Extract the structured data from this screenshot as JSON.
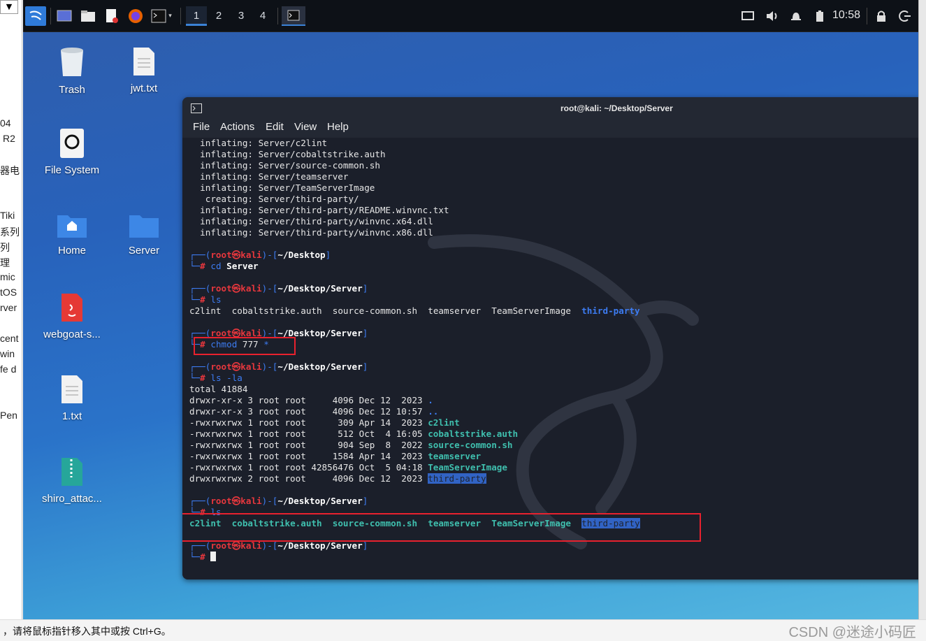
{
  "host": {
    "left_texts": [
      "04",
      "R2",
      "器电",
      "Tiki",
      "系列",
      "列",
      "理",
      "mic",
      "tOS",
      "rver",
      "cent",
      "win",
      "fe d",
      "Pen"
    ],
    "status_text": "，请将鼠标指针移入其中或按 Ctrl+G。",
    "watermark": "CSDN @迷途小码匠",
    "dropdown_glyph": "▼"
  },
  "taskbar": {
    "workspaces": [
      "1",
      "2",
      "3",
      "4"
    ],
    "active_workspace": "1",
    "clock": "10:58"
  },
  "desktop_icons": [
    {
      "label": "Trash",
      "icon": "trash-icon"
    },
    {
      "label": "jwt.txt",
      "icon": "text-file-icon"
    },
    {
      "label": "File System",
      "icon": "drive-icon"
    },
    {
      "label": "Home",
      "icon": "home-folder-icon"
    },
    {
      "label": "Server",
      "icon": "folder-icon"
    },
    {
      "label": "webgoat-s...",
      "icon": "java-file-icon"
    },
    {
      "label": "1.txt",
      "icon": "text-file-icon"
    },
    {
      "label": "shiro_attac...",
      "icon": "archive-icon"
    }
  ],
  "terminal": {
    "title": "root@kali: ~/Desktop/Server",
    "menu": [
      "File",
      "Actions",
      "Edit",
      "View",
      "Help"
    ],
    "unzip_lines": [
      "  inflating: Server/c2lint",
      "  inflating: Server/cobaltstrike.auth",
      "  inflating: Server/source-common.sh",
      "  inflating: Server/teamserver",
      "  inflating: Server/TeamServerImage",
      "   creating: Server/third-party/",
      "  inflating: Server/third-party/README.winvnc.txt",
      "  inflating: Server/third-party/winvnc.x64.dll",
      "  inflating: Server/third-party/winvnc.x86.dll"
    ],
    "prompt_user": "root",
    "prompt_host": "kali",
    "prompt_skull": "㉿",
    "prompt_hash": "#",
    "prompt_top_left": "┌──(",
    "prompt_bottom_left": "└─",
    "paths": {
      "desktop": "~/Desktop",
      "server": "~/Desktop/Server"
    },
    "commands": {
      "cd": "cd",
      "cd_arg": "Server",
      "ls": "ls",
      "chmod": "chmod",
      "chmod_mode": "777",
      "chmod_glob": "*",
      "lsla": "ls -la"
    },
    "ls_files": [
      "c2lint",
      "cobaltstrike.auth",
      "source-common.sh",
      "teamserver",
      "TeamServerImage",
      "third-party"
    ],
    "total_line": "total 41884",
    "lsla_rows": [
      {
        "meta": "drwxr-xr-x 3 root root     4096 Dec 12  2023 ",
        "name": "."
      },
      {
        "meta": "drwxr-xr-x 3 root root     4096 Dec 12 10:57 ",
        "name": ".."
      },
      {
        "meta": "-rwxrwxrwx 1 root root      309 Apr 14  2023 ",
        "name": "c2lint"
      },
      {
        "meta": "-rwxrwxrwx 1 root root      512 Oct  4 16:05 ",
        "name": "cobaltstrike.auth"
      },
      {
        "meta": "-rwxrwxrwx 1 root root      904 Sep  8  2022 ",
        "name": "source-common.sh"
      },
      {
        "meta": "-rwxrwxrwx 1 root root     1584 Apr 14  2023 ",
        "name": "teamserver"
      },
      {
        "meta": "-rwxrwxrwx 1 root root 42856476 Oct  5 04:18 ",
        "name": "TeamServerImage"
      },
      {
        "meta": "drwxrwxrwx 2 root root     4096 Dec 12  2023 ",
        "name": "third-party"
      }
    ]
  }
}
